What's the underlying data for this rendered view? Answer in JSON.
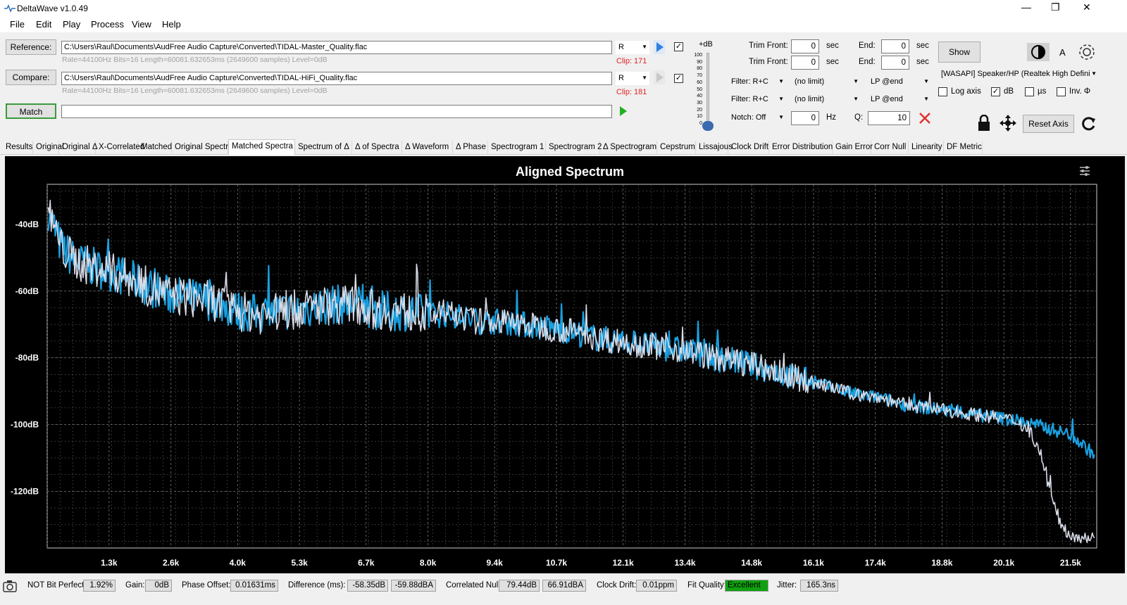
{
  "window": {
    "title": "DeltaWave v1.0.49",
    "minimize": "—",
    "maximize": "❐",
    "close": "✕"
  },
  "menu": [
    "File",
    "Edit",
    "Play",
    "Process",
    "View",
    "Help"
  ],
  "reference": {
    "button": "Reference:",
    "path": "C:\\Users\\Raul\\Documents\\AudFree Audio Capture\\Converted\\TIDAL-Master_Quality.flac",
    "meta": "Rate=44100Hz Bits=16 Length=60081.632653ms (2649600 samples) Level=0dB",
    "channel": "R",
    "clip": "Clip: 171"
  },
  "compare": {
    "button": "Compare:",
    "path": "C:\\Users\\Raul\\Documents\\AudFree Audio Capture\\Converted\\TIDAL-HiFi_Quality.flac",
    "meta": "Rate=44100Hz Bits=16 Length=60081.632653ms (2649600 samples) Level=0dB",
    "channel": "R",
    "clip": "Clip: 181"
  },
  "match": {
    "button": "Match",
    "progress": ""
  },
  "volume": {
    "label": "+dB",
    "ticks": [
      "100",
      "90",
      "80",
      "70",
      "60",
      "50",
      "40",
      "30",
      "20",
      "10",
      "0"
    ]
  },
  "trim": {
    "front_label": "Trim Front:",
    "end_label": "End:",
    "unit": "sec",
    "ref_front": "0",
    "ref_end": "0",
    "cmp_front": "0",
    "cmp_end": "0"
  },
  "filters": {
    "filter1": "Filter: R+C",
    "limit1": "(no limit)",
    "lp1": "LP @end",
    "filter2": "Filter: R+C",
    "limit2": "(no limit)",
    "lp2": "LP @end",
    "notch": "Notch: Off",
    "notch_hz": "0",
    "hz": "Hz",
    "q_label": "Q:",
    "q_value": "10"
  },
  "output": {
    "show": "Show",
    "device": "[WASAPI] Speaker/HP (Realtek High Defini",
    "a_label": "A"
  },
  "options": {
    "log_axis": "Log axis",
    "db": "dB",
    "us": "µs",
    "inv": "Inv. Φ",
    "reset_axis": "Reset Axis"
  },
  "tabs": [
    "Results",
    "Original",
    "Original Δ",
    "X-Correlated",
    "Matched",
    "Original Spectra",
    "Matched Spectra",
    "Spectrum of Δ",
    "Δ of Spectra",
    "Δ Waveform",
    "Δ Phase",
    "Spectrogram 1",
    "Spectrogram 2",
    "Δ Spectrogram",
    "Cepstrum",
    "Lissajous",
    "Clock Drift",
    "Error Distribution",
    "Gain Error",
    "Corr Null",
    "Linearity",
    "DF Metric"
  ],
  "active_tab": "Matched Spectra",
  "chart_data": {
    "type": "line",
    "title": "Aligned Spectrum",
    "xlabel": "",
    "ylabel": "",
    "x_unit": "Hz",
    "xlim": [
      0,
      22050
    ],
    "ylim": [
      -137,
      -28
    ],
    "xticks": [
      {
        "v": 1300,
        "label": "1.3k"
      },
      {
        "v": 2600,
        "label": "2.6k"
      },
      {
        "v": 4000,
        "label": "4.0k"
      },
      {
        "v": 5300,
        "label": "5.3k"
      },
      {
        "v": 6700,
        "label": "6.7k"
      },
      {
        "v": 8000,
        "label": "8.0k"
      },
      {
        "v": 9400,
        "label": "9.4k"
      },
      {
        "v": 10700,
        "label": "10.7k"
      },
      {
        "v": 12100,
        "label": "12.1k"
      },
      {
        "v": 13400,
        "label": "13.4k"
      },
      {
        "v": 14800,
        "label": "14.8k"
      },
      {
        "v": 16100,
        "label": "16.1k"
      },
      {
        "v": 17400,
        "label": "17.4k"
      },
      {
        "v": 18800,
        "label": "18.8k"
      },
      {
        "v": 20100,
        "label": "20.1k"
      },
      {
        "v": 21500,
        "label": "21.5k"
      }
    ],
    "yticks": [
      {
        "v": -40,
        "label": "-40dB"
      },
      {
        "v": -60,
        "label": "-60dB"
      },
      {
        "v": -80,
        "label": "-80dB"
      },
      {
        "v": -100,
        "label": "-100dB"
      },
      {
        "v": -120,
        "label": "-120dB"
      }
    ],
    "grid": true,
    "series": [
      {
        "color": "#1aa0e0",
        "x": [
          20,
          300,
          600,
          1000,
          1500,
          2000,
          2500,
          3000,
          3500,
          4000,
          4500,
          5000,
          5500,
          6000,
          6500,
          7000,
          7500,
          8000,
          8500,
          9000,
          9500,
          10000,
          10500,
          11000,
          11500,
          12000,
          12500,
          13000,
          13500,
          14000,
          14500,
          15000,
          15500,
          16000,
          16500,
          17000,
          17500,
          18000,
          18500,
          19000,
          19500,
          20000,
          20500,
          21000,
          21500,
          22000
        ],
        "y": [
          -36,
          -47,
          -51,
          -53,
          -55,
          -58,
          -61,
          -62,
          -63,
          -66,
          -67,
          -66,
          -65,
          -64,
          -64,
          -66,
          -66,
          -67,
          -67,
          -69,
          -69,
          -70,
          -71,
          -72,
          -74,
          -75,
          -76,
          -77,
          -78,
          -80,
          -81,
          -83,
          -85,
          -87,
          -89,
          -91,
          -92,
          -94,
          -95,
          -96,
          -97,
          -98,
          -99,
          -101,
          -103,
          -109
        ]
      },
      {
        "color": "#d8dce8",
        "x": [
          20,
          300,
          600,
          1000,
          1500,
          2000,
          2500,
          3000,
          3500,
          4000,
          4500,
          5000,
          5500,
          6000,
          6500,
          7000,
          7500,
          8000,
          8500,
          9000,
          9500,
          10000,
          10500,
          11000,
          11500,
          12000,
          12500,
          13000,
          13500,
          14000,
          14500,
          15000,
          15500,
          16000,
          16500,
          17000,
          17500,
          18000,
          18500,
          19000,
          19500,
          20000,
          20400,
          20700,
          20900,
          21100,
          21300,
          21500,
          22000
        ],
        "y": [
          -36,
          -47,
          -51,
          -53,
          -55,
          -58,
          -61,
          -62,
          -63,
          -66,
          -67,
          -66,
          -65,
          -64,
          -64,
          -66,
          -66,
          -67,
          -67,
          -69,
          -69,
          -70,
          -71,
          -72,
          -74,
          -75,
          -76,
          -77,
          -78,
          -80,
          -81,
          -83,
          -85,
          -87,
          -89,
          -91,
          -92,
          -94,
          -95,
          -96,
          -97,
          -98,
          -99,
          -103,
          -110,
          -122,
          -130,
          -133,
          -134
        ]
      }
    ]
  },
  "status": {
    "bit_perfect_label": "NOT Bit Perfect",
    "bit_perfect": "1.92%",
    "gain_label": "Gain:",
    "gain": "0dB",
    "phase_label": "Phase Offset:",
    "phase": "0.01631ms",
    "diff_label": "Difference (ms):",
    "diff_db": "-58.35dB",
    "diff_dba": "-59.88dBA",
    "null_label": "Correlated Null:",
    "null_db": "79.44dB",
    "null_dba": "66.91dBA",
    "drift_label": "Clock Drift:",
    "drift": "0.01ppm",
    "fit_label": "Fit Quality:",
    "fit": "Excellent",
    "jitter_label": "Jitter:",
    "jitter": "165.3ns"
  }
}
